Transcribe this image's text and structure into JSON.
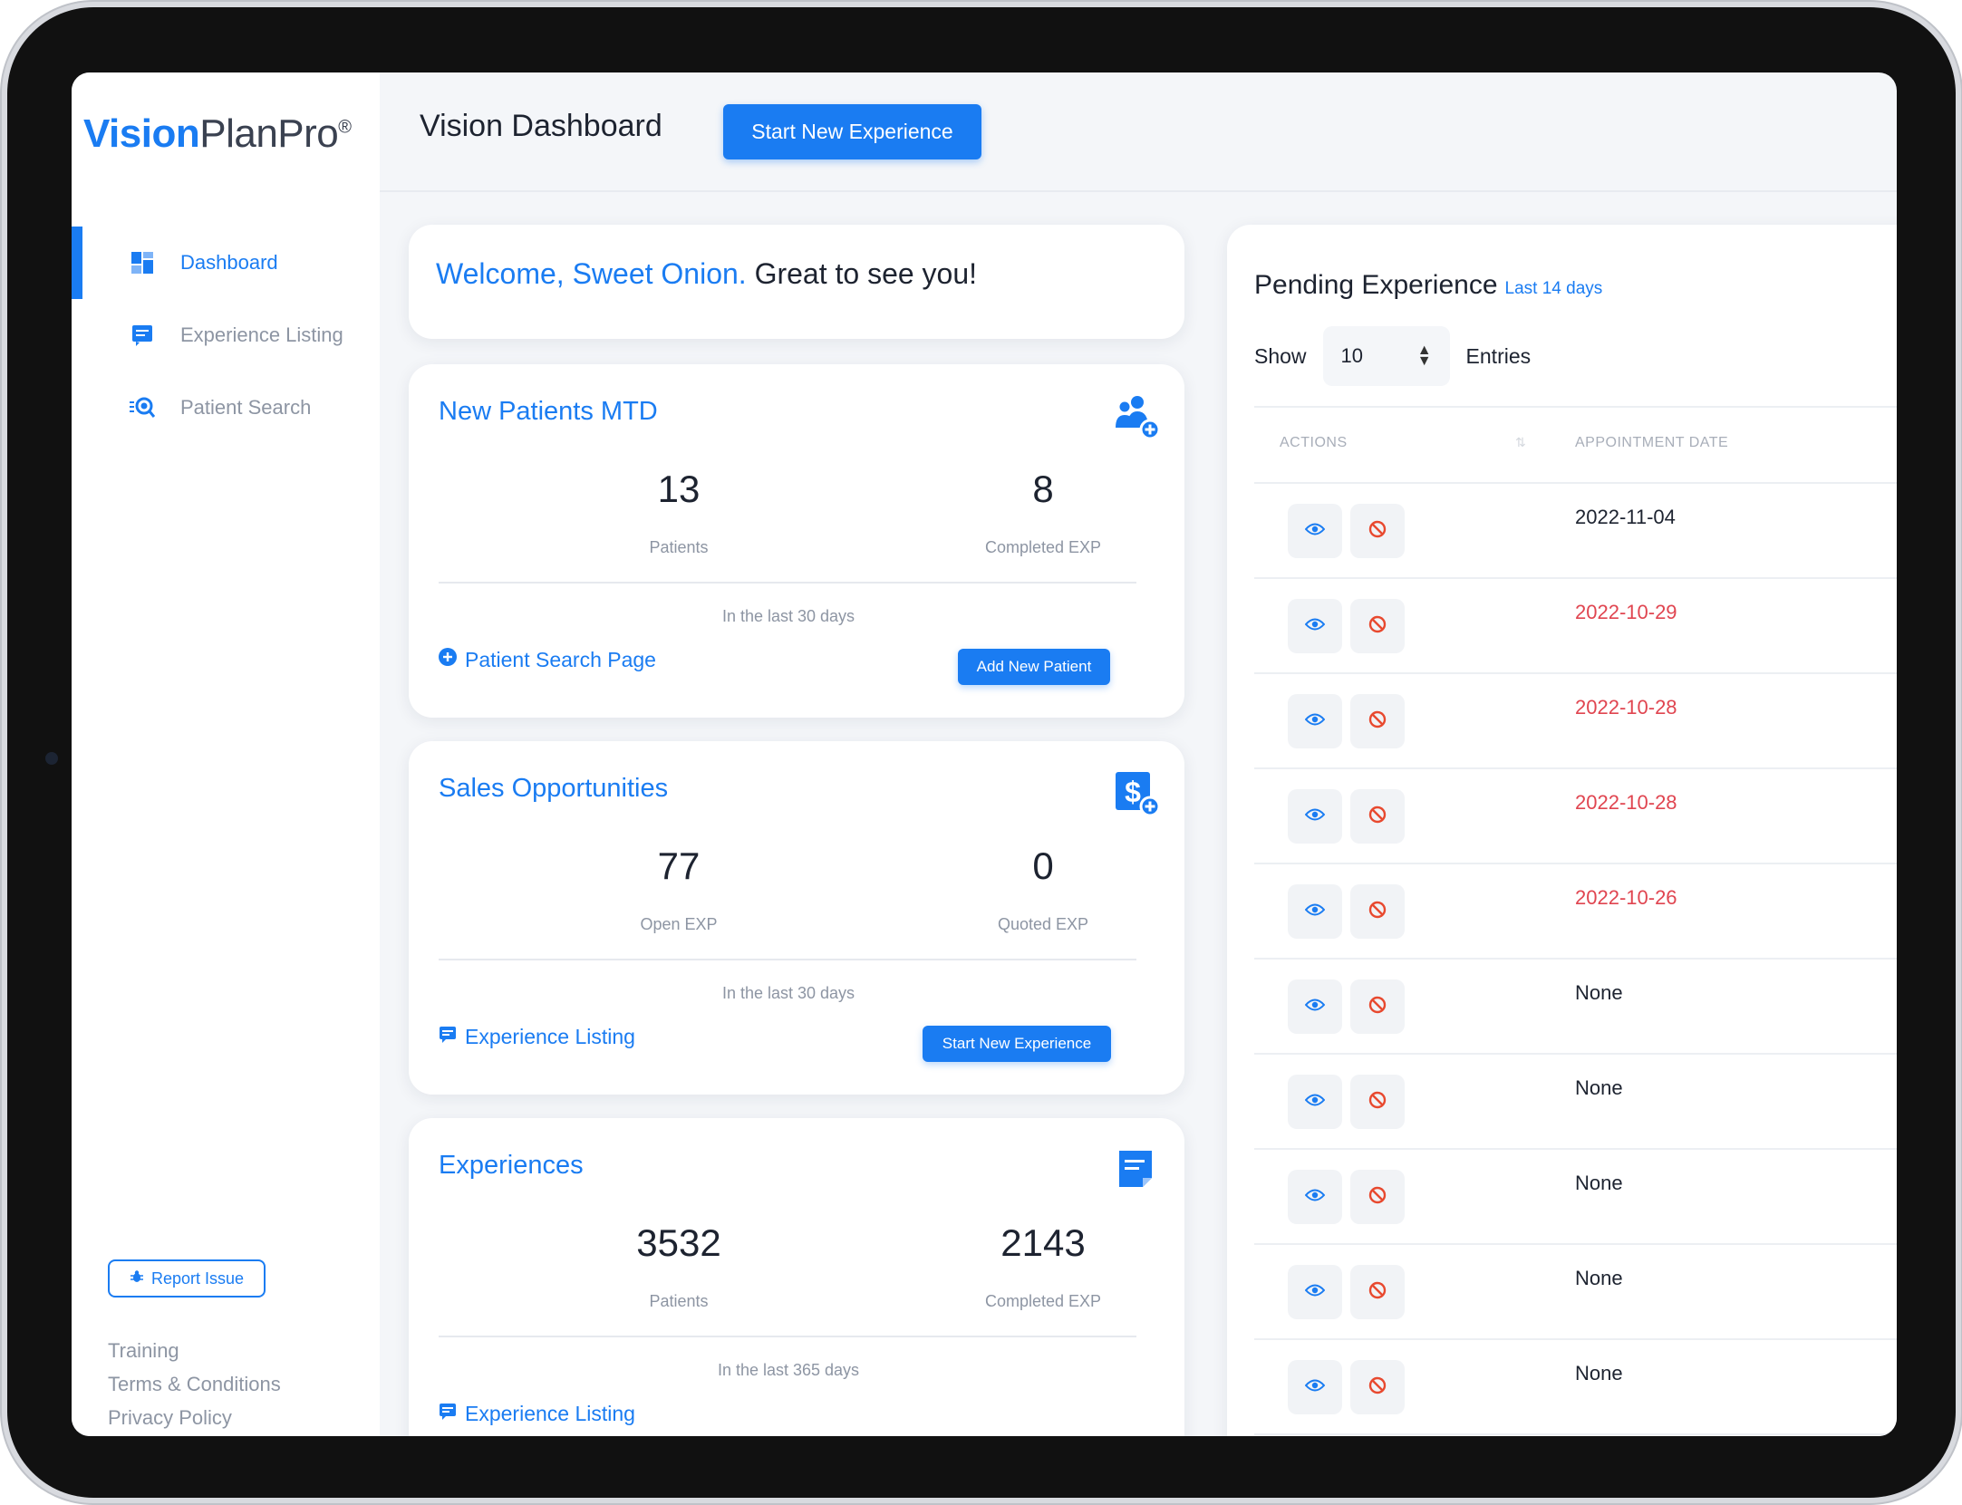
{
  "brand": {
    "bold": "Vision",
    "light": "PlanPro",
    "mark": "®"
  },
  "header": {
    "title": "Vision Dashboard",
    "cta": "Start New Experience"
  },
  "sidebar": {
    "items": [
      {
        "label": "Dashboard",
        "icon": "dashboard-icon",
        "active": true
      },
      {
        "label": "Experience Listing",
        "icon": "list-icon",
        "active": false
      },
      {
        "label": "Patient Search",
        "icon": "patient-search-icon",
        "active": false
      }
    ],
    "report": "Report Issue",
    "footer": [
      "Training",
      "Terms & Conditions",
      "Privacy Policy"
    ]
  },
  "welcome": {
    "highlight": "Welcome, Sweet Onion.",
    "rest": " Great to see you!"
  },
  "cards": [
    {
      "title": "New Patients MTD",
      "icon": "add-patients-icon",
      "stat1": {
        "value": "13",
        "label": "Patients"
      },
      "stat2": {
        "value": "8",
        "label": "Completed EXP"
      },
      "period": "In the last 30 days",
      "link": "Patient Search Page",
      "button": "Add New Patient"
    },
    {
      "title": "Sales Opportunities",
      "icon": "dollar-add-icon",
      "stat1": {
        "value": "77",
        "label": "Open EXP"
      },
      "stat2": {
        "value": "0",
        "label": "Quoted EXP"
      },
      "period": "In the last 30 days",
      "link": "Experience Listing",
      "button": "Start New Experience"
    },
    {
      "title": "Experiences",
      "icon": "notepad-icon",
      "stat1": {
        "value": "3532",
        "label": "Patients"
      },
      "stat2": {
        "value": "2143",
        "label": "Completed EXP"
      },
      "period": "In the last 365 days",
      "link": "Experience Listing"
    }
  ],
  "pending": {
    "title": "Pending Experience",
    "subtitle": "Last 14 days",
    "show_label": "Show",
    "entries_value": "10",
    "entries_label": "Entries",
    "columns": [
      "ACTIONS",
      "APPOINTMENT DATE"
    ],
    "rows": [
      {
        "date": "2022-11-04",
        "late": false
      },
      {
        "date": "2022-10-29",
        "late": true
      },
      {
        "date": "2022-10-28",
        "late": true
      },
      {
        "date": "2022-10-28",
        "late": true
      },
      {
        "date": "2022-10-26",
        "late": true
      },
      {
        "date": "None",
        "late": false
      },
      {
        "date": "None",
        "late": false
      },
      {
        "date": "None",
        "late": false
      },
      {
        "date": "None",
        "late": false
      },
      {
        "date": "None",
        "late": false
      }
    ]
  },
  "colors": {
    "accent": "#1a7cf2",
    "late": "#e04550",
    "muted": "#8d95a3"
  }
}
